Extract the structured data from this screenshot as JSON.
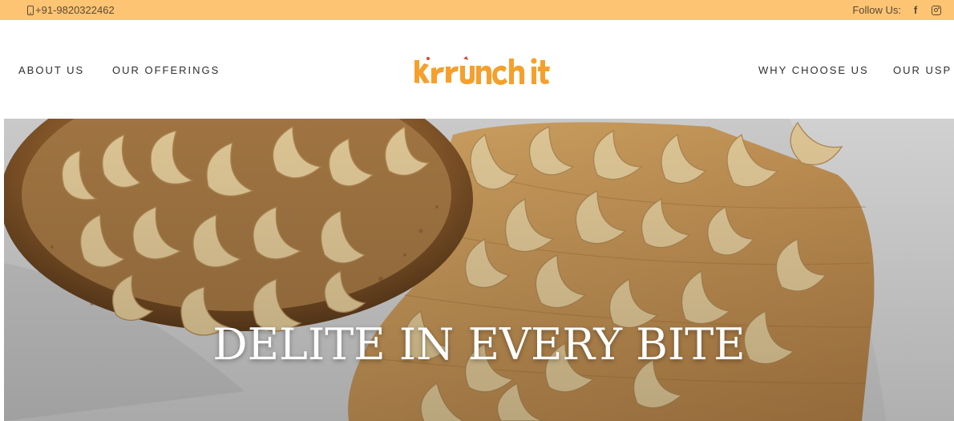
{
  "topbar": {
    "phone": "+91-9820322462",
    "follow_label": "Follow Us:",
    "social_icons": [
      "facebook-icon",
      "instagram-icon"
    ],
    "background": "#fdc473"
  },
  "nav": {
    "left": [
      "ABOUT US",
      "OUR OFFERINGS"
    ],
    "right": [
      "WHY CHOOSE US",
      "OUR USP"
    ],
    "logo_text": "krrunch it",
    "logo_color": "#f5a02c"
  },
  "hero": {
    "title": "DELITE IN EVERY BITE",
    "image": "cashews in wooden bowl on cutting board"
  }
}
